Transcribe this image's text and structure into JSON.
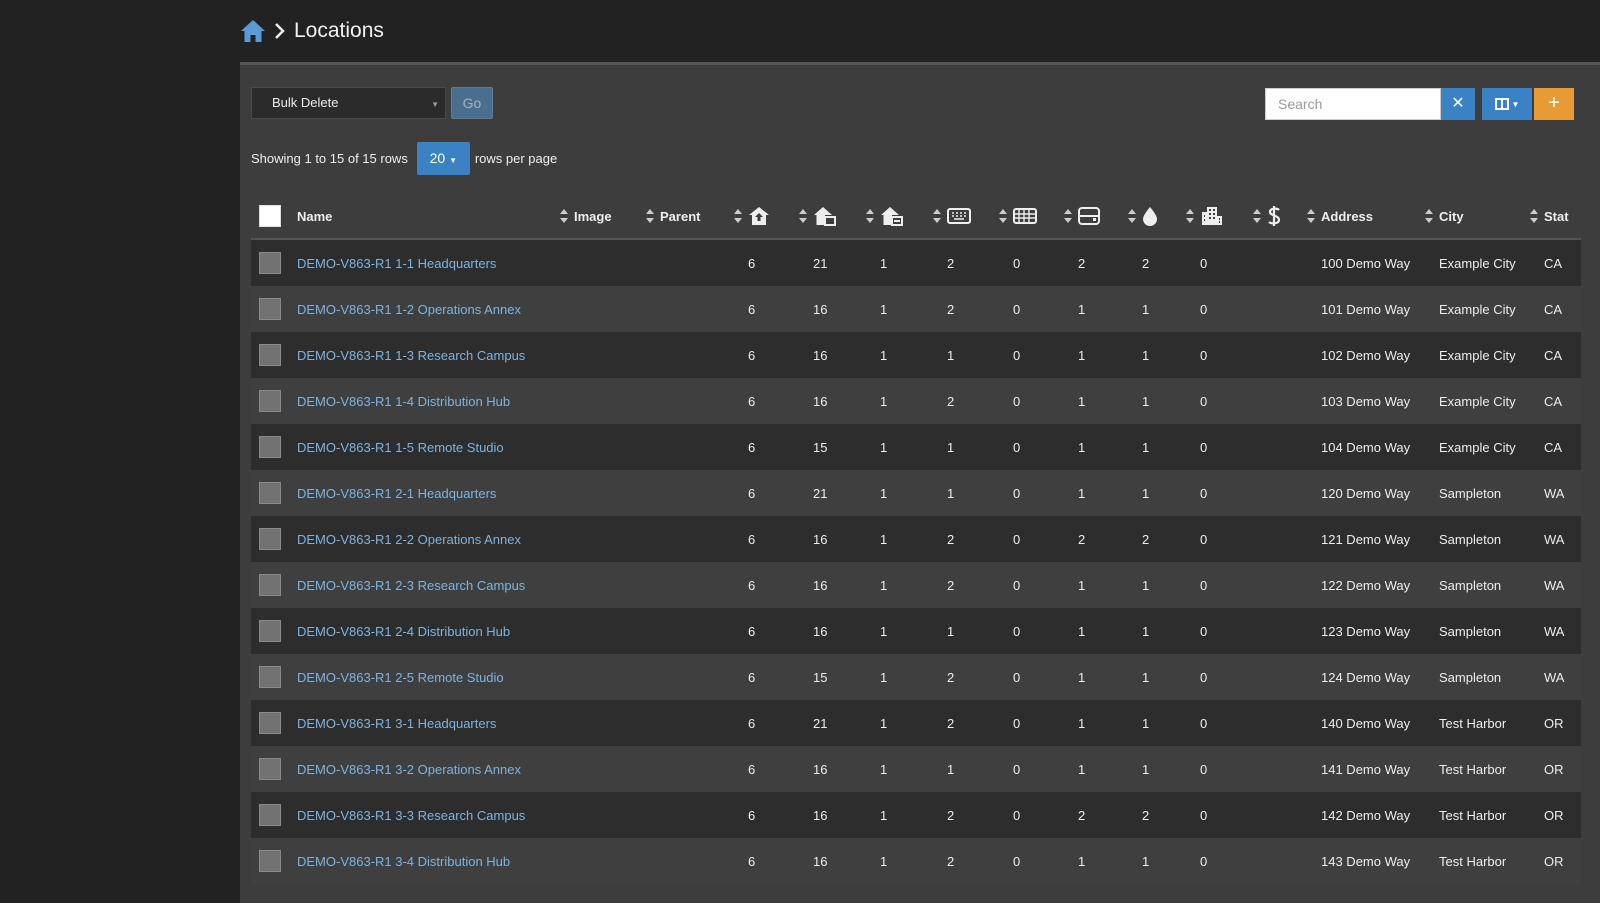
{
  "breadcrumb": {
    "home_icon": "home-icon",
    "separator_icon": "chevron-right-icon",
    "title": "Locations"
  },
  "toolbar": {
    "bulk_action": "Bulk Delete",
    "go_label": "Go",
    "search_placeholder": "Search",
    "clear_label": "✕",
    "columns_icon": "columns-icon",
    "add_label": "+"
  },
  "pagination": {
    "showing_text": "Showing 1 to 15 of 15 rows",
    "page_size": "20",
    "rows_per_page_text": "rows per page"
  },
  "columns": [
    {
      "key": "name",
      "label": "Name"
    },
    {
      "key": "image",
      "label": "Image"
    },
    {
      "key": "parent",
      "label": "Parent"
    },
    {
      "key": "c1",
      "icon": "building-up-icon"
    },
    {
      "key": "c2",
      "icon": "building-left-icon"
    },
    {
      "key": "c3",
      "icon": "building-right-icon"
    },
    {
      "key": "c4",
      "icon": "keyboard-icon"
    },
    {
      "key": "c5",
      "icon": "keyboard-grid-icon"
    },
    {
      "key": "c6",
      "icon": "hard-drive-icon"
    },
    {
      "key": "c7",
      "icon": "droplet-icon"
    },
    {
      "key": "c8",
      "icon": "city-icon"
    },
    {
      "key": "c9",
      "icon": "dollar-icon"
    },
    {
      "key": "address",
      "label": "Address"
    },
    {
      "key": "city",
      "label": "City"
    },
    {
      "key": "state",
      "label": "Stat"
    }
  ],
  "rows": [
    {
      "name": "DEMO-V863-R1 1-1 Headquarters",
      "c1": "6",
      "c2": "21",
      "c3": "1",
      "c4": "2",
      "c5": "0",
      "c6": "2",
      "c7": "2",
      "c8": "0",
      "address": "100 Demo Way",
      "city": "Example City",
      "state": "CA"
    },
    {
      "name": "DEMO-V863-R1 1-2 Operations Annex",
      "c1": "6",
      "c2": "16",
      "c3": "1",
      "c4": "2",
      "c5": "0",
      "c6": "1",
      "c7": "1",
      "c8": "0",
      "address": "101 Demo Way",
      "city": "Example City",
      "state": "CA"
    },
    {
      "name": "DEMO-V863-R1 1-3 Research Campus",
      "c1": "6",
      "c2": "16",
      "c3": "1",
      "c4": "1",
      "c5": "0",
      "c6": "1",
      "c7": "1",
      "c8": "0",
      "address": "102 Demo Way",
      "city": "Example City",
      "state": "CA"
    },
    {
      "name": "DEMO-V863-R1 1-4 Distribution Hub",
      "c1": "6",
      "c2": "16",
      "c3": "1",
      "c4": "2",
      "c5": "0",
      "c6": "1",
      "c7": "1",
      "c8": "0",
      "address": "103 Demo Way",
      "city": "Example City",
      "state": "CA"
    },
    {
      "name": "DEMO-V863-R1 1-5 Remote Studio",
      "c1": "6",
      "c2": "15",
      "c3": "1",
      "c4": "1",
      "c5": "0",
      "c6": "1",
      "c7": "1",
      "c8": "0",
      "address": "104 Demo Way",
      "city": "Example City",
      "state": "CA"
    },
    {
      "name": "DEMO-V863-R1 2-1 Headquarters",
      "c1": "6",
      "c2": "21",
      "c3": "1",
      "c4": "1",
      "c5": "0",
      "c6": "1",
      "c7": "1",
      "c8": "0",
      "address": "120 Demo Way",
      "city": "Sampleton",
      "state": "WA"
    },
    {
      "name": "DEMO-V863-R1 2-2 Operations Annex",
      "c1": "6",
      "c2": "16",
      "c3": "1",
      "c4": "2",
      "c5": "0",
      "c6": "2",
      "c7": "2",
      "c8": "0",
      "address": "121 Demo Way",
      "city": "Sampleton",
      "state": "WA"
    },
    {
      "name": "DEMO-V863-R1 2-3 Research Campus",
      "c1": "6",
      "c2": "16",
      "c3": "1",
      "c4": "2",
      "c5": "0",
      "c6": "1",
      "c7": "1",
      "c8": "0",
      "address": "122 Demo Way",
      "city": "Sampleton",
      "state": "WA"
    },
    {
      "name": "DEMO-V863-R1 2-4 Distribution Hub",
      "c1": "6",
      "c2": "16",
      "c3": "1",
      "c4": "1",
      "c5": "0",
      "c6": "1",
      "c7": "1",
      "c8": "0",
      "address": "123 Demo Way",
      "city": "Sampleton",
      "state": "WA"
    },
    {
      "name": "DEMO-V863-R1 2-5 Remote Studio",
      "c1": "6",
      "c2": "15",
      "c3": "1",
      "c4": "2",
      "c5": "0",
      "c6": "1",
      "c7": "1",
      "c8": "0",
      "address": "124 Demo Way",
      "city": "Sampleton",
      "state": "WA"
    },
    {
      "name": "DEMO-V863-R1 3-1 Headquarters",
      "c1": "6",
      "c2": "21",
      "c3": "1",
      "c4": "2",
      "c5": "0",
      "c6": "1",
      "c7": "1",
      "c8": "0",
      "address": "140 Demo Way",
      "city": "Test Harbor",
      "state": "OR"
    },
    {
      "name": "DEMO-V863-R1 3-2 Operations Annex",
      "c1": "6",
      "c2": "16",
      "c3": "1",
      "c4": "1",
      "c5": "0",
      "c6": "1",
      "c7": "1",
      "c8": "0",
      "address": "141 Demo Way",
      "city": "Test Harbor",
      "state": "OR"
    },
    {
      "name": "DEMO-V863-R1 3-3 Research Campus",
      "c1": "6",
      "c2": "16",
      "c3": "1",
      "c4": "2",
      "c5": "0",
      "c6": "2",
      "c7": "2",
      "c8": "0",
      "address": "142 Demo Way",
      "city": "Test Harbor",
      "state": "OR"
    },
    {
      "name": "DEMO-V863-R1 3-4 Distribution Hub",
      "c1": "6",
      "c2": "16",
      "c3": "1",
      "c4": "2",
      "c5": "0",
      "c6": "1",
      "c7": "1",
      "c8": "0",
      "address": "143 Demo Way",
      "city": "Test Harbor",
      "state": "OR"
    }
  ],
  "colors": {
    "accent": "#3b82c4",
    "add": "#e89b33",
    "link": "#7fb3dd",
    "background": "#222222",
    "panel": "#3d3d3d"
  }
}
